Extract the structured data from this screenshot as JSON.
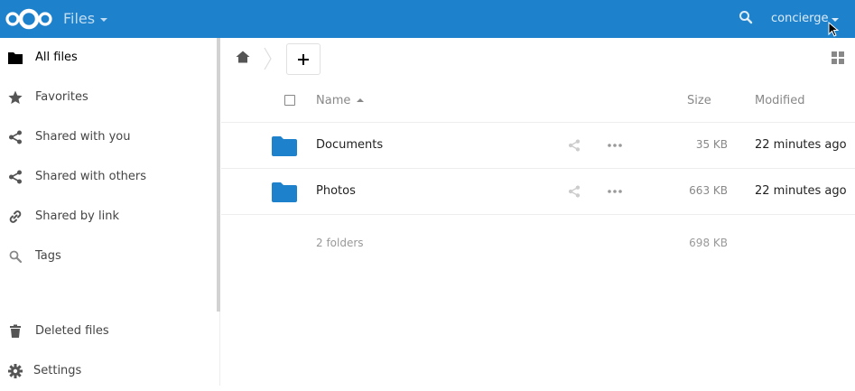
{
  "header": {
    "app_name": "Files",
    "user": "concierge",
    "brand_color": "#1e81cc"
  },
  "sidebar": {
    "items": [
      {
        "label": "All files",
        "icon": "folder-icon",
        "active": true
      },
      {
        "label": "Favorites",
        "icon": "star-icon"
      },
      {
        "label": "Shared with you",
        "icon": "share-icon"
      },
      {
        "label": "Shared with others",
        "icon": "share-icon"
      },
      {
        "label": "Shared by link",
        "icon": "link-icon"
      },
      {
        "label": "Tags",
        "icon": "search-icon"
      }
    ],
    "bottom_items": [
      {
        "label": "Deleted files",
        "icon": "trash-icon"
      },
      {
        "label": "Settings",
        "icon": "gear-icon"
      }
    ]
  },
  "controls": {
    "new_label": "+"
  },
  "table": {
    "columns": {
      "name": "Name",
      "size": "Size",
      "modified": "Modified"
    },
    "rows": [
      {
        "name": "Documents",
        "size": "35 KB",
        "modified": "22 minutes ago",
        "icon": "folder-icon"
      },
      {
        "name": "Photos",
        "size": "663 KB",
        "modified": "22 minutes ago",
        "icon": "folder-icon"
      }
    ],
    "summary": {
      "count": "2 folders",
      "size": "698 KB"
    }
  }
}
